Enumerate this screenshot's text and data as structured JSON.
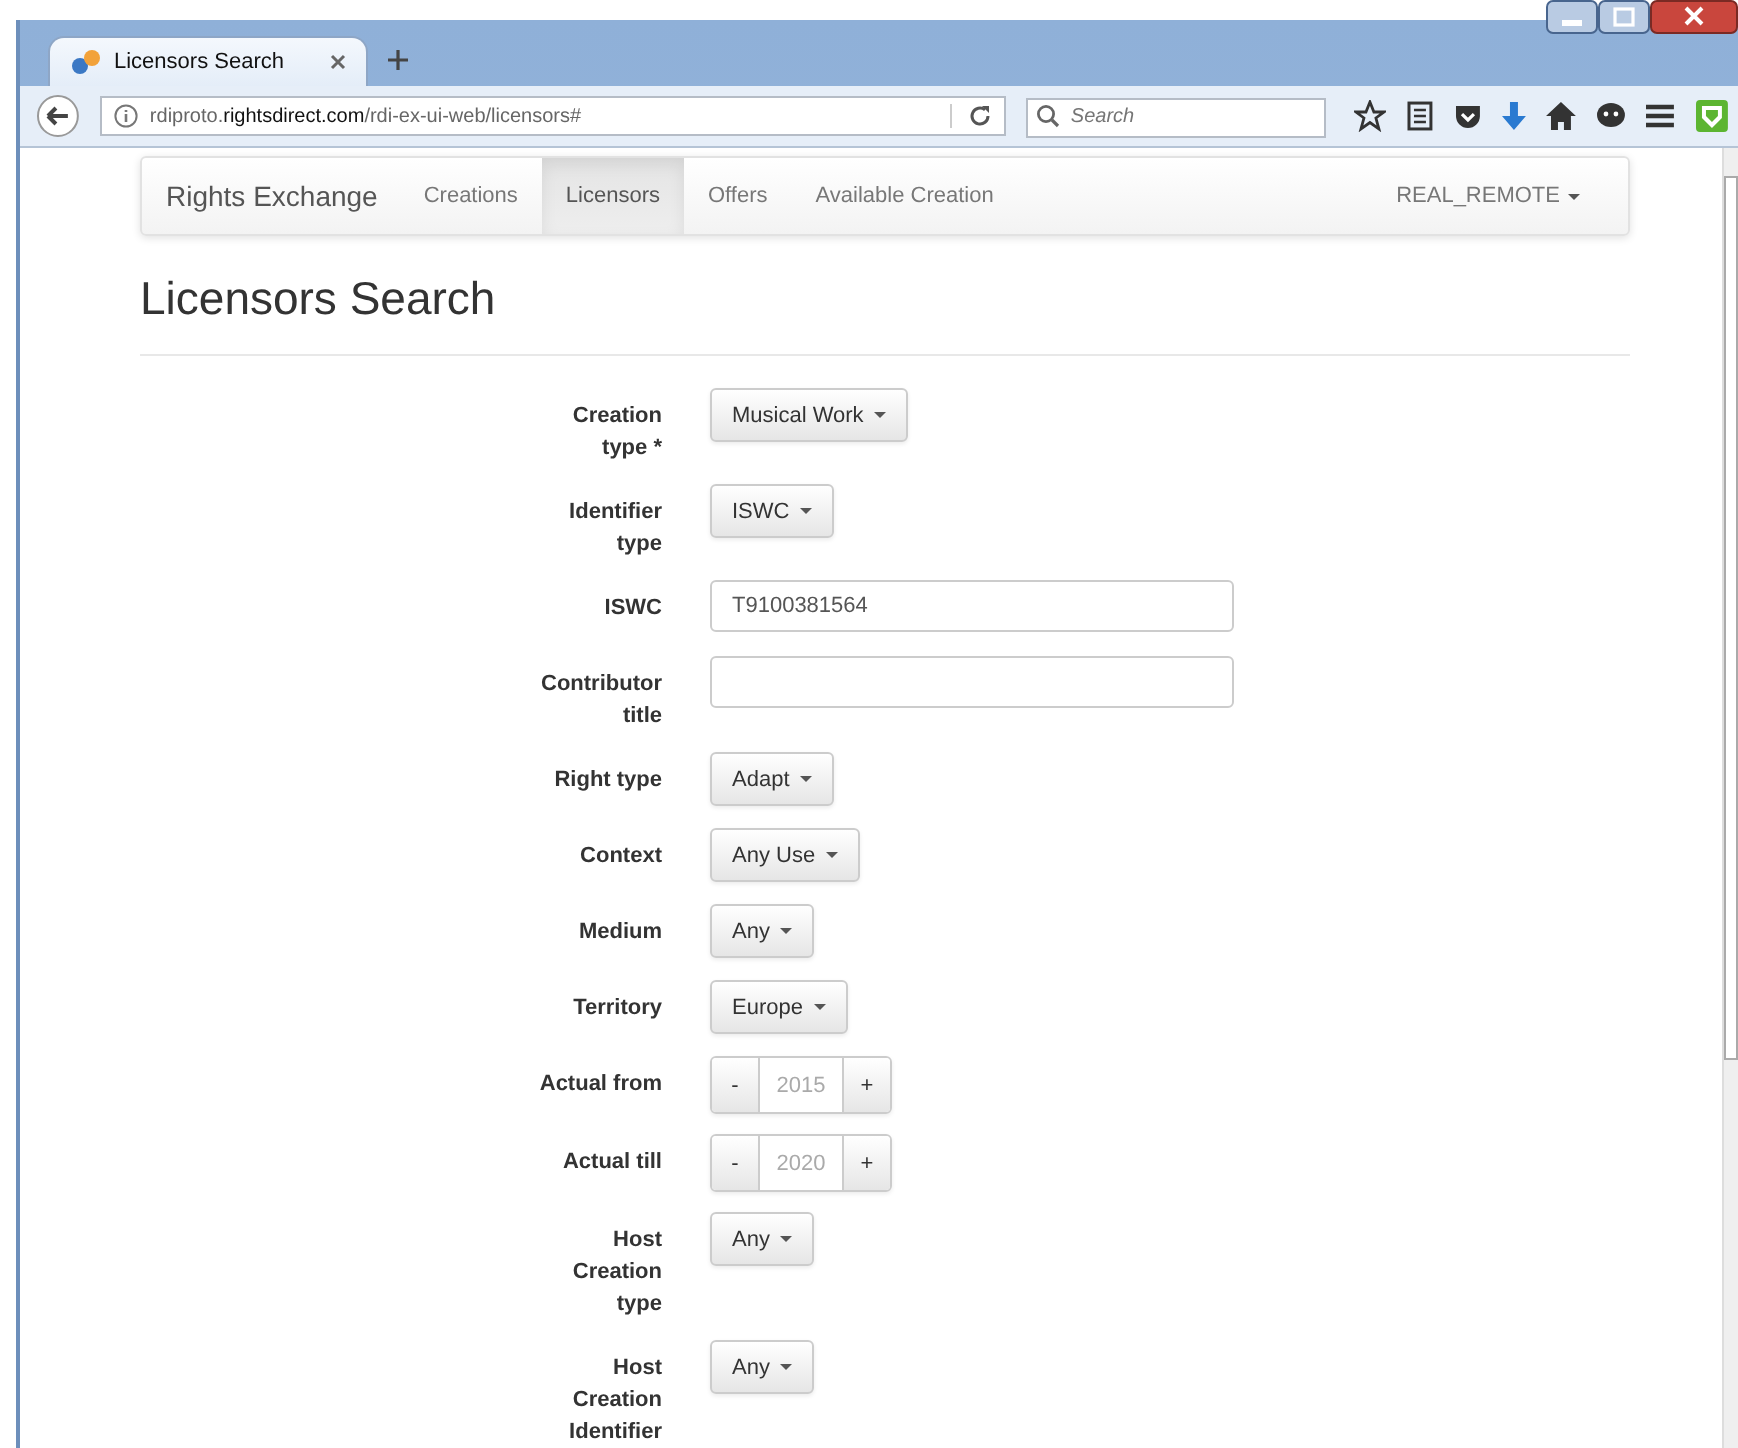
{
  "browser": {
    "tab_title": "Licensors Search",
    "url": "rdiproto.**rightsdirect.com**/rdi-ex-ui-web/licensors#",
    "search": {
      "placeholder": "Search"
    }
  },
  "navbar": {
    "brand": "Rights Exchange",
    "items": [
      {
        "label": "Creations",
        "selected": false
      },
      {
        "label": "Licensors",
        "selected": true
      },
      {
        "label": "Offers",
        "selected": false
      },
      {
        "label": "Available Creation",
        "selected": false
      }
    ],
    "user_menu": "REAL_REMOTE"
  },
  "heading": "Licensors Search",
  "fields": [
    {
      "kind": "dropdown",
      "label": "Creation type *",
      "value": "Musical Work"
    },
    {
      "kind": "dropdown",
      "label": "Identifier type",
      "value": "ISWC"
    },
    {
      "kind": "text",
      "label": "ISWC",
      "value": "T9100381564"
    },
    {
      "kind": "text",
      "label": "Contributor title"
    },
    {
      "kind": "dropdown",
      "label": "Right type",
      "value": "Adapt"
    },
    {
      "kind": "dropdown",
      "label": "Context",
      "value": "Any Use"
    },
    {
      "kind": "dropdown",
      "label": "Medium",
      "value": "Any"
    },
    {
      "kind": "dropdown",
      "label": "Territory",
      "value": "Europe"
    },
    {
      "kind": "stepper",
      "label": "Actual from",
      "placeholder": "2015",
      "minus": "-",
      "plus": "+"
    },
    {
      "kind": "stepper",
      "label": "Actual till",
      "placeholder": "2020",
      "minus": "-",
      "plus": "+"
    },
    {
      "kind": "dropdown",
      "label": "Host Creation type",
      "value": "Any"
    },
    {
      "kind": "dropdown",
      "label": "Host Creation Identifier",
      "value": "Any"
    }
  ]
}
